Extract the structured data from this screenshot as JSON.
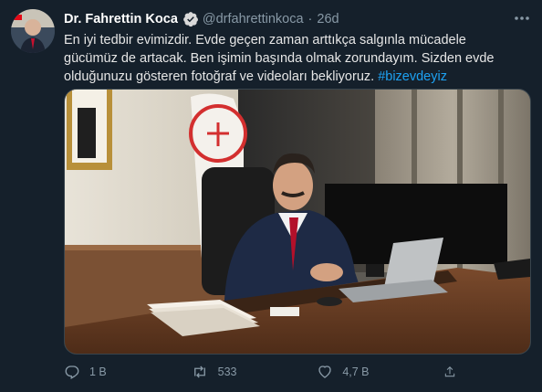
{
  "tweet": {
    "author_name": "Dr. Fahrettin Koca",
    "handle": "@drfahrettinkoca",
    "separator": "·",
    "time": "26d",
    "text": "En iyi tedbir evimizdir. Evde geçen zaman arttıkça salgınla mücadele\ngücümüz de artacak. Ben işimin başında olmak zorundayım. Sizden evde\nolduğunuzu gösteren fotoğraf ve videoları bekliyoruz. ",
    "hashtag": "#bizevdeyiz"
  },
  "actions": {
    "reply_count": "1 B",
    "retweet_count": "533",
    "like_count": "4,7 B"
  },
  "icons": {
    "verified": "verified-badge-icon",
    "more": "more-options-icon",
    "reply": "reply-icon",
    "retweet": "retweet-icon",
    "like": "like-icon",
    "share": "share-icon"
  },
  "colors": {
    "background": "#15202b",
    "accent": "#1da1f2",
    "muted": "#8899a6",
    "text": "#e6e6e6"
  }
}
